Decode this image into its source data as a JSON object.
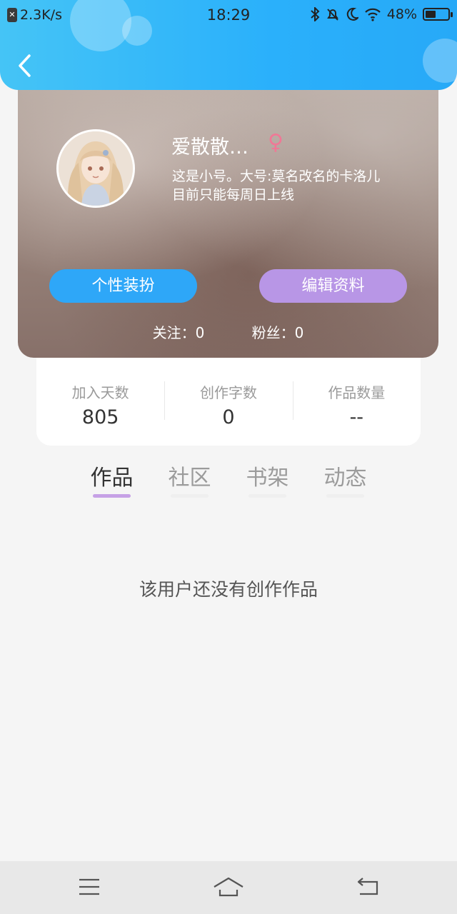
{
  "status_bar": {
    "network_speed": "2.3K/s",
    "time": "18:29",
    "battery_percent": "48%",
    "battery_level": 0.48
  },
  "profile": {
    "username": "爱散散…",
    "gender_symbol": "♀",
    "bio_line1": "这是小号。大号:莫名改名的卡洛儿",
    "bio_line2": "目前只能每周日上线",
    "dress_button": "个性装扮",
    "edit_button": "编辑资料",
    "following": "关注：0",
    "followers": "粉丝：0"
  },
  "stats": [
    {
      "label": "加入天数",
      "value": "805"
    },
    {
      "label": "创作字数",
      "value": "0"
    },
    {
      "label": "作品数量",
      "value": "--"
    }
  ],
  "tabs": [
    {
      "label": "作品",
      "active": true
    },
    {
      "label": "社区",
      "active": false
    },
    {
      "label": "书架",
      "active": false
    },
    {
      "label": "动态",
      "active": false
    }
  ],
  "empty_message": "该用户还没有创作作品",
  "colors": {
    "header": "#2ab0fb",
    "dress_button": "#2ea7f8",
    "edit_button": "#b896e6",
    "tab_indicator": "#c6a1e6",
    "gender": "#f07896"
  },
  "icons": {
    "back": "chevron-left-icon",
    "nav_menu": "menu-icon",
    "nav_home": "home-icon",
    "nav_back": "back-arrow-icon"
  }
}
